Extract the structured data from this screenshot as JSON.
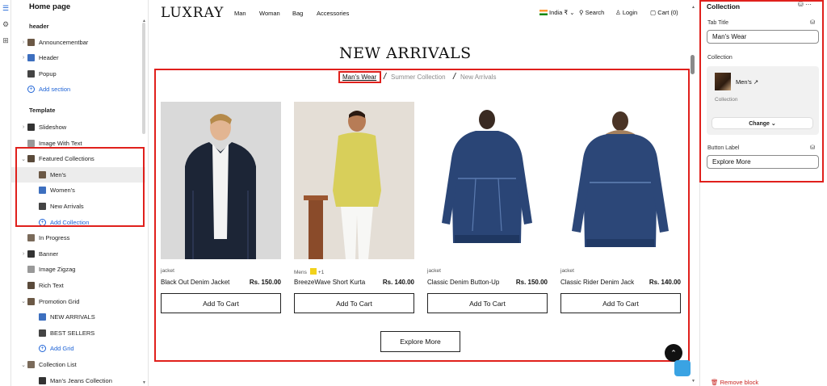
{
  "sidebar": {
    "title": "Home page",
    "items": [
      {
        "label": "header",
        "type": "section"
      },
      {
        "label": "Announcementbar",
        "type": "item",
        "chev": ">"
      },
      {
        "label": "Header",
        "type": "item",
        "chev": ">"
      },
      {
        "label": "Popup",
        "type": "item"
      },
      {
        "label": "Add section",
        "type": "add"
      },
      {
        "label": "Template",
        "type": "section"
      },
      {
        "label": "Slideshow",
        "type": "item",
        "chev": ">"
      },
      {
        "label": "Image With Text",
        "type": "item"
      },
      {
        "label": "Featured Collections",
        "type": "item",
        "chev": "v"
      },
      {
        "label": "Men's",
        "type": "child",
        "selected": true
      },
      {
        "label": "Women's",
        "type": "child"
      },
      {
        "label": "New Arrivals",
        "type": "child"
      },
      {
        "label": "Add Collection",
        "type": "add-child"
      },
      {
        "label": "In Progress",
        "type": "item"
      },
      {
        "label": "Banner",
        "type": "item",
        "chev": ">"
      },
      {
        "label": "Image Zigzag",
        "type": "item"
      },
      {
        "label": "Rich Text",
        "type": "item"
      },
      {
        "label": "Promotion Grid",
        "type": "item",
        "chev": "v"
      },
      {
        "label": "NEW ARRIVALS",
        "type": "child"
      },
      {
        "label": "BEST SELLERS",
        "type": "child"
      },
      {
        "label": "Add Grid",
        "type": "add-child"
      },
      {
        "label": "Collection List",
        "type": "item",
        "chev": "v"
      },
      {
        "label": "Man's Jeans Collection",
        "type": "child"
      }
    ]
  },
  "store": {
    "logo": "LUXRAY",
    "nav": [
      "Man",
      "Woman",
      "Bag",
      "Accessories"
    ],
    "currency": "India ₹",
    "search": "Search",
    "login": "Login",
    "cart": "Cart (0)"
  },
  "featured": {
    "title": "NEW ARRIVALS",
    "tabs": [
      "Man's Wear",
      "Summer Collection",
      "New Arrivals"
    ],
    "products": [
      {
        "category": "jacket",
        "name": "Black Out Denim Jacket",
        "price": "Rs. 150.00",
        "button": "Add To Cart"
      },
      {
        "category": "Mens",
        "extra": "+1",
        "name": "BreezeWave Short Kurta",
        "price": "Rs. 140.00",
        "button": "Add To Cart"
      },
      {
        "category": "jacket",
        "name": "Classic Denim Button-Up",
        "price": "Rs. 150.00",
        "button": "Add To Cart"
      },
      {
        "category": "jacket",
        "name": "Classic Rider Denim Jack",
        "price": "Rs. 140.00",
        "button": "Add To Cart"
      }
    ],
    "explore": "Explore More"
  },
  "panel": {
    "title": "Collection",
    "tab_title_label": "Tab Title",
    "tab_title_value": "Man's Wear",
    "collection_label": "Collection",
    "collection_name": "Men's",
    "collection_sub": "Collection",
    "change_label": "Change",
    "button_label_label": "Button Label",
    "button_label_value": "Explore More",
    "remove": "Remove block"
  },
  "colors": {
    "accent": "#1e63d6",
    "highlight": "#e0201c",
    "danger": "#c7221e"
  }
}
